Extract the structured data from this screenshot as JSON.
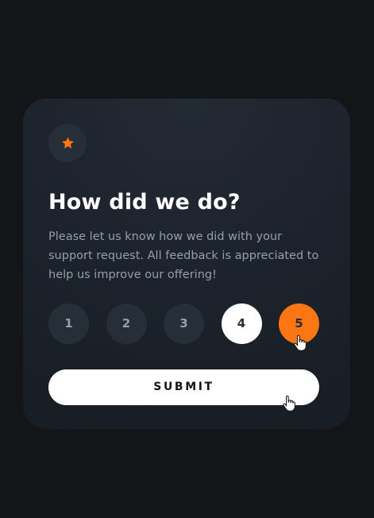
{
  "card": {
    "icon": "star-icon",
    "title": "How did we do?",
    "description": "Please let us know how we did with your support request. All feedback is appreciated to help us improve our offering!"
  },
  "ratings": {
    "options": [
      "1",
      "2",
      "3",
      "4",
      "5"
    ],
    "hovered": "4",
    "selected": "5"
  },
  "submit": {
    "label": "SUBMIT"
  },
  "cursors": [
    "hand-pointer-icon",
    "hand-pointer-icon"
  ],
  "colors": {
    "background": "#141519",
    "card": "#1f2630",
    "accent": "#fc7614",
    "muted_circle": "#262e38",
    "text_muted": "#959eac",
    "white": "#ffffff"
  }
}
